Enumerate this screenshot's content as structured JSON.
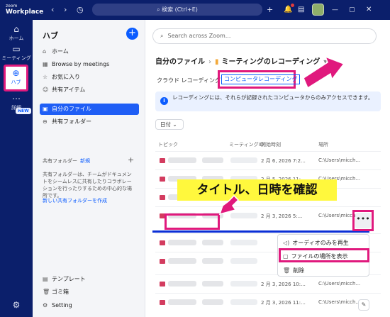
{
  "app": {
    "logo_line1": "zoom",
    "logo_line2": "Workplace"
  },
  "titlebar": {
    "search_label": "検索 (Ctrl+E)",
    "plus_icon": "+",
    "bell_icon": "🔔",
    "min_icon": "—",
    "max_icon": "▢",
    "close_icon": "✕"
  },
  "rail": {
    "items": [
      {
        "label": "ホーム",
        "icon": "⌂"
      },
      {
        "label": "ミーティング",
        "icon": "▭"
      },
      {
        "label": "ハブ",
        "icon": "⊕"
      },
      {
        "label": "詳細",
        "icon": "⋯"
      }
    ],
    "new_badge": "NEW",
    "settings_icon": "⚙"
  },
  "hub": {
    "title": "ハブ",
    "add_icon": "+",
    "nav": [
      {
        "label": "ホーム",
        "icon": "⌂"
      },
      {
        "label": "Browse by meetings",
        "icon": "▦"
      },
      {
        "label": "お気に入り",
        "icon": "☆"
      },
      {
        "label": "共有アイテム",
        "icon": "☺"
      },
      {
        "label": "自分のファイル",
        "icon": "▣"
      },
      {
        "label": "共有フォルダー",
        "icon": "⊖"
      }
    ],
    "shared_header": "共有フォルダー",
    "shared_new": "新規",
    "shared_desc": "共有フォルダーは、チームがドキュメントをシームレスに共有したりコラボレーションを行ったりするための中心的な場所です。",
    "shared_link": "新しい共有フォルダーを作成",
    "bottom": [
      {
        "label": "テンプレート",
        "icon": "▤"
      },
      {
        "label": "ゴミ箱",
        "icon": "🗑"
      },
      {
        "label": "Setting",
        "icon": "⚙"
      }
    ]
  },
  "main": {
    "search_placeholder": "Search across Zoom...",
    "breadcrumb_root": "自分のファイル",
    "breadcrumb_sep": "›",
    "breadcrumb_current": "ミーティングのレコーディング",
    "breadcrumb_chevron": "▾",
    "tab_cloud": "クラウド レコーディング",
    "tab_computer": "コンピュータレコーディング",
    "info_text": "レコーディングには、それらが記録されたコンピュータからのみアクセスできます。",
    "date_filter": "日付 ⌄",
    "columns": [
      "トピック",
      "ミーティングID",
      "開始時刻",
      "場所"
    ],
    "rows": [
      {
        "date": "2 月 6, 2026 7:2...",
        "loc": "C:\\Users\\micch..."
      },
      {
        "date": "2 月 5, 2026 11:...",
        "loc": "C:\\Users\\micch..."
      },
      {
        "date": "",
        "loc": ""
      },
      {
        "date": "2 月 3, 2026 5:...",
        "loc": "C:\\Users\\micch..."
      },
      {
        "date": "",
        "loc": ""
      },
      {
        "date": "",
        "loc": ""
      },
      {
        "date": "2 月 3, 2026 10:...",
        "loc": "C:\\Users\\micch..."
      },
      {
        "date": "2 月 3, 2026 11:...",
        "loc": "C:\\Users\\micch..."
      }
    ],
    "more_label": "•••",
    "context_menu": [
      {
        "label": "オーディオのみを再生",
        "icon": "◁)"
      },
      {
        "label": "ファイルの場所を表示",
        "icon": "▢"
      },
      {
        "label": "削除",
        "icon": "🗑"
      }
    ]
  },
  "annotation": {
    "banner_text": "タイトル、日時を確認"
  },
  "colors": {
    "brand": "#0b1f6b",
    "accent": "#0b5cff",
    "highlight": "#e0197d",
    "banner": "#fff83d"
  }
}
